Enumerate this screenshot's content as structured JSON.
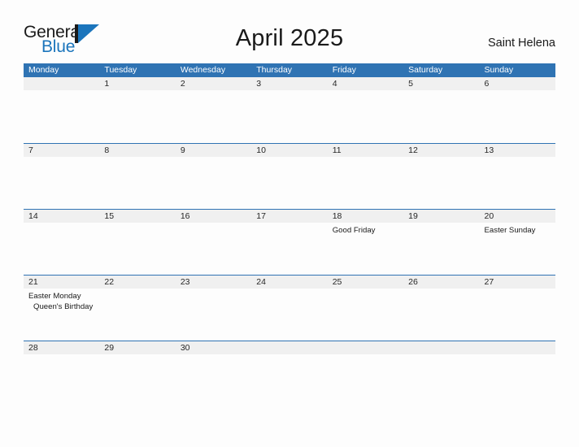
{
  "brand": {
    "name_part1": "General",
    "name_part2": "Blue",
    "logo_icon": "triangle-flag-icon",
    "accent_color": "#1b75bc"
  },
  "header": {
    "title": "April 2025",
    "location": "Saint Helena"
  },
  "calendar": {
    "header_bg": "#2f73b3",
    "band_bg": "#f0f0f0",
    "weekdays": [
      "Monday",
      "Tuesday",
      "Wednesday",
      "Thursday",
      "Friday",
      "Saturday",
      "Sunday"
    ],
    "weeks": [
      {
        "days": [
          {
            "number": "",
            "events": []
          },
          {
            "number": "1",
            "events": []
          },
          {
            "number": "2",
            "events": []
          },
          {
            "number": "3",
            "events": []
          },
          {
            "number": "4",
            "events": []
          },
          {
            "number": "5",
            "events": []
          },
          {
            "number": "6",
            "events": []
          }
        ]
      },
      {
        "days": [
          {
            "number": "7",
            "events": []
          },
          {
            "number": "8",
            "events": []
          },
          {
            "number": "9",
            "events": []
          },
          {
            "number": "10",
            "events": []
          },
          {
            "number": "11",
            "events": []
          },
          {
            "number": "12",
            "events": []
          },
          {
            "number": "13",
            "events": []
          }
        ]
      },
      {
        "days": [
          {
            "number": "14",
            "events": []
          },
          {
            "number": "15",
            "events": []
          },
          {
            "number": "16",
            "events": []
          },
          {
            "number": "17",
            "events": []
          },
          {
            "number": "18",
            "events": [
              "Good Friday"
            ]
          },
          {
            "number": "19",
            "events": []
          },
          {
            "number": "20",
            "events": [
              "Easter Sunday"
            ]
          }
        ]
      },
      {
        "days": [
          {
            "number": "21",
            "events": [
              "Easter Monday",
              "Queen's Birthday"
            ]
          },
          {
            "number": "22",
            "events": []
          },
          {
            "number": "23",
            "events": []
          },
          {
            "number": "24",
            "events": []
          },
          {
            "number": "25",
            "events": []
          },
          {
            "number": "26",
            "events": []
          },
          {
            "number": "27",
            "events": []
          }
        ]
      },
      {
        "days": [
          {
            "number": "28",
            "events": []
          },
          {
            "number": "29",
            "events": []
          },
          {
            "number": "30",
            "events": []
          },
          {
            "number": "",
            "events": []
          },
          {
            "number": "",
            "events": []
          },
          {
            "number": "",
            "events": []
          },
          {
            "number": "",
            "events": []
          }
        ]
      }
    ]
  }
}
